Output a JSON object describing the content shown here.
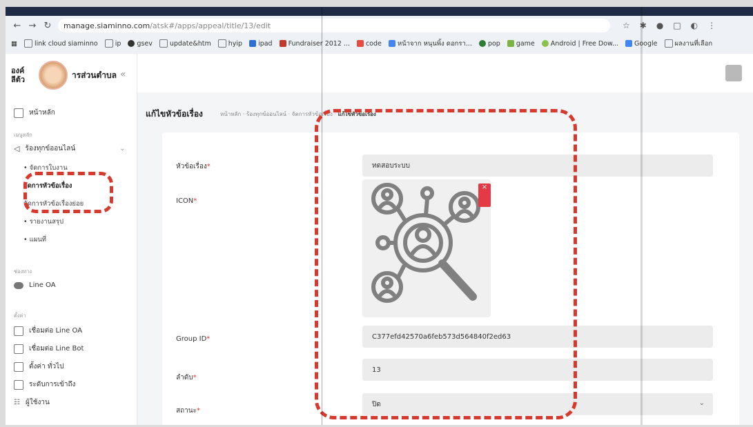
{
  "browser": {
    "address_host": "manage.siaminno.com",
    "address_path": "/atsk#/apps/appeal/title/13/edit",
    "bookmarks": [
      "link cloud siaminno",
      "ip",
      "gsev",
      "update&htm",
      "hyip",
      "ipad",
      "Fundraiser 2012 ...",
      "code",
      "หน้าจาก หนุนพิ้ง ดอกรา...",
      "pop",
      "game",
      "Android | Free Dow...",
      "Google",
      "ผลงานที่เลือก"
    ]
  },
  "sidebar": {
    "brand_line1": "องค์",
    "brand_line2": "ารส่วนตำบล",
    "brand_line3": "ลีต้ว",
    "home": "หน้าหลัก",
    "section_menu": "เมนูหลัก",
    "group_label": "ร้องทุกข์ออนไลน์",
    "sub_items": [
      "จัดการใบงาน",
      "จัดการหัวข้อเรื่อง",
      "จัดการหัวข้อเรื่องย่อย",
      "รายงานสรุป",
      "แผนที่"
    ],
    "section_channel": "ช่องทาง",
    "line_oa": "Line OA",
    "section_settings": "ตั้งค่า",
    "settings_items": [
      "เชื่อมต่อ Line OA",
      "เชื่อมต่อ Line Bot",
      "ตั้งค่า ทั่วไป",
      "ระดับการเข้าถึง",
      "ผู้ใช้งาน"
    ]
  },
  "page": {
    "title": "แก้ไขหัวข้อเรื่อง",
    "breadcrumb": [
      "หน้าหลัก",
      "ร้องทุกข์ออนไลน์",
      "จัดการหัวข้อเรื่อง",
      "แก้ไขหัวข้อเรื่อง"
    ]
  },
  "form": {
    "subject_label": "หัวข้อเรื่อง",
    "subject_value": "ทดสอบระบบ",
    "icon_label": "ICON",
    "remove_icon": "×",
    "group_id_label": "Group ID",
    "group_id_value": "C377efd42570a6feb573d564840f2ed63",
    "order_label": "ลำดับ",
    "order_value": "13",
    "status_label": "สถานะ",
    "status_value": "ปิด"
  },
  "colors": {
    "highlight": "#d63a2e",
    "required": "#e03131"
  }
}
